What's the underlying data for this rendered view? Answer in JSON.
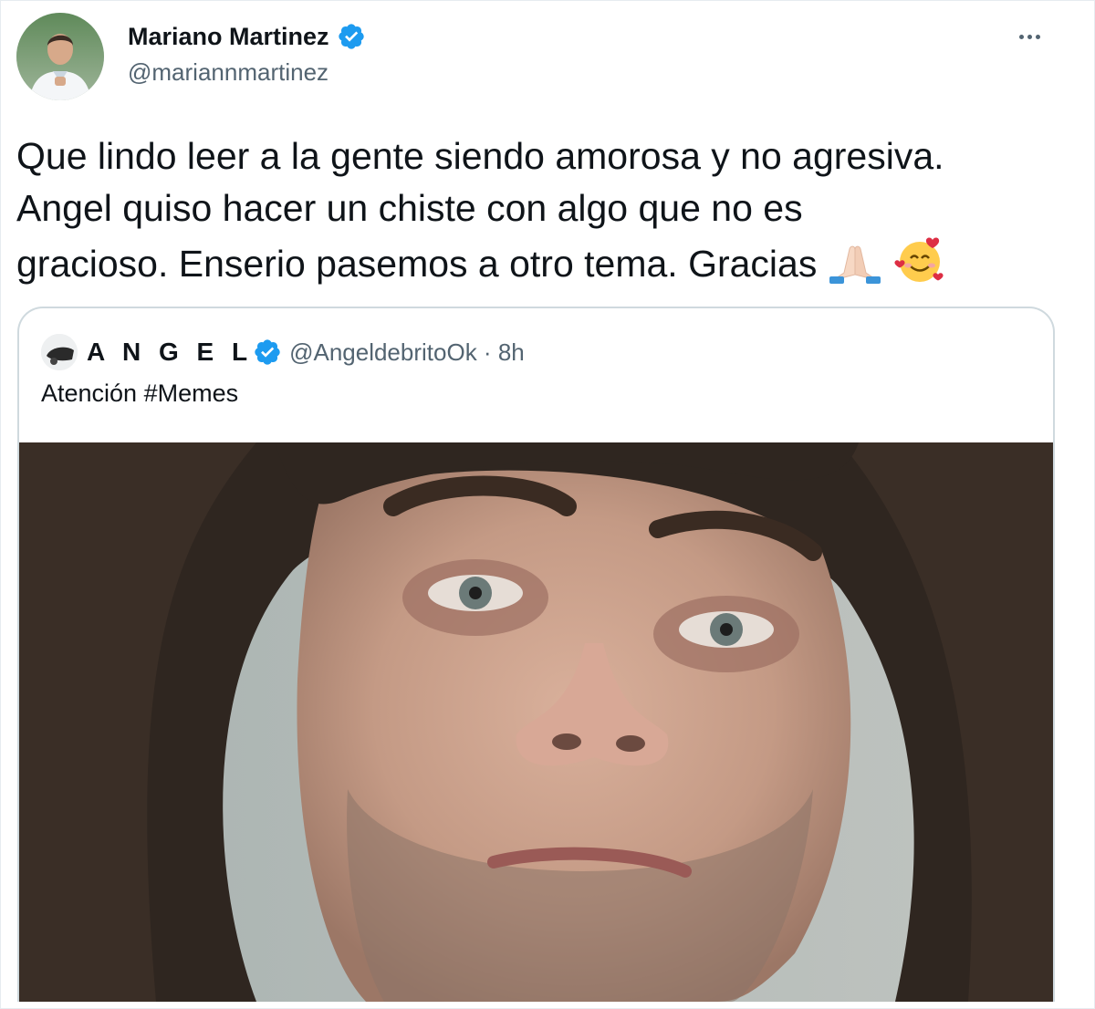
{
  "tweet": {
    "author": {
      "name": "Mariano Martinez",
      "handle": "@mariannmartinez",
      "verified": true
    },
    "text_lines": [
      "Que lindo leer a la gente siendo amorosa y no agresiva.",
      "Angel quiso hacer un chiste con algo que no es",
      "gracioso. Enserio pasemos a otro tema. Gracias"
    ],
    "emojis": [
      "folded-hands",
      "smiling-face-with-hearts"
    ],
    "quote": {
      "author": {
        "name": "A N G E L",
        "handle": "@AngeldebritoOk",
        "time": "8h",
        "verified": true
      },
      "text": "Atención #Memes"
    }
  },
  "colors": {
    "verified_blue": "#1d9bf0",
    "secondary_text": "#536471",
    "border": "#cfd9de"
  }
}
